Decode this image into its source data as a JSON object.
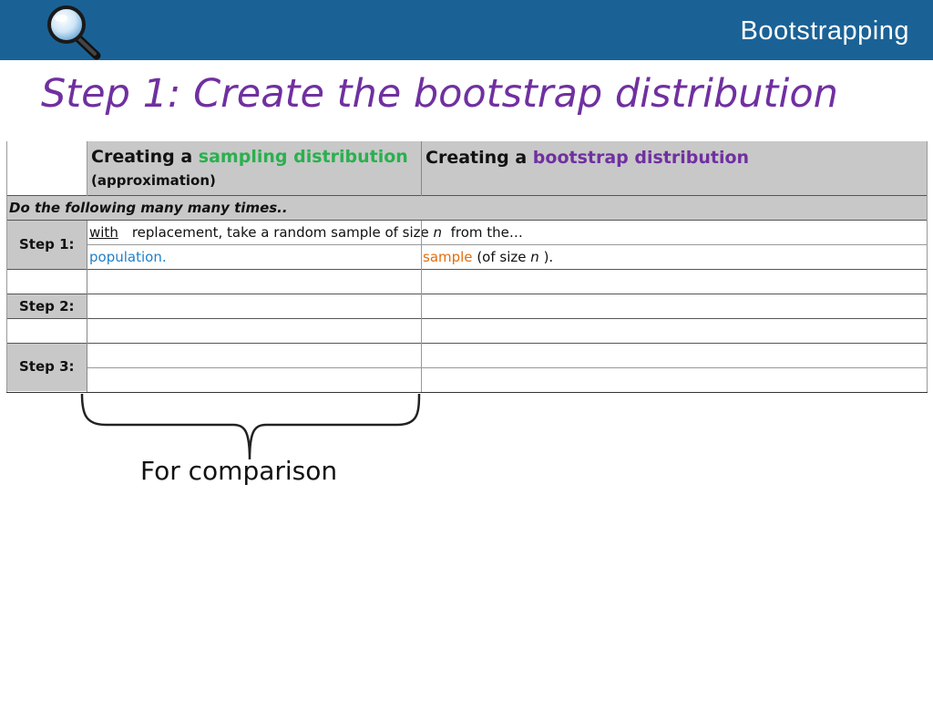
{
  "header": {
    "title": "Bootstrapping",
    "icon": "magnifying-glass-icon",
    "bg_color": "#1a6296"
  },
  "slide": {
    "title": "Step 1: Create the bootstrap distribution",
    "title_color": "#7030a0"
  },
  "table": {
    "col1_header_prefix": "Creating a ",
    "col1_header_highlight": "sampling distribution",
    "col1_header_sub": "(approximation)",
    "col2_header_prefix": "Creating a ",
    "col2_header_highlight": "bootstrap distribution",
    "banner_row": "Do the following many many times..",
    "step1_label": "Step 1:",
    "step1_with": "with",
    "step1_text": "replacement, take a random sample of size ",
    "step1_n": "n",
    "step1_from": "from the…",
    "step1_population": "population.",
    "step1_sample": "sample",
    "step1_of_size": "(of size ",
    "step1_n2": "n",
    "step1_close": ").",
    "step2_label": "Step 2:",
    "step3_label": "Step 3:",
    "colors": {
      "sampling": "#2ab04e",
      "bootstrap": "#7030a0",
      "population": "#1f7fc9",
      "sample": "#e46c0a",
      "header_gray": "#c8c8c8"
    }
  },
  "annotation": {
    "brace_label": "For comparison"
  }
}
